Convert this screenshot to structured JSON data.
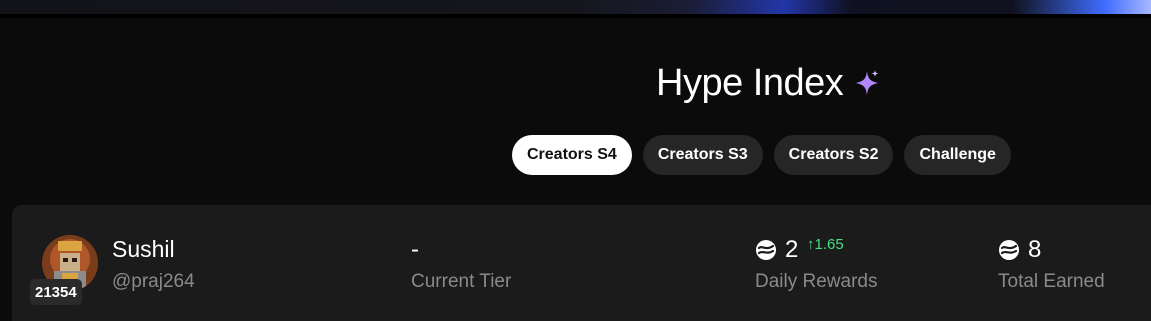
{
  "header": {
    "title": "Hype Index",
    "title_icon": "sparkle-icon",
    "sparkle_color": "#b388ff"
  },
  "tabs": [
    {
      "label": "Creators S4",
      "active": true
    },
    {
      "label": "Creators S3",
      "active": false
    },
    {
      "label": "Creators S2",
      "active": false
    },
    {
      "label": "Challenge",
      "active": false
    }
  ],
  "leaderboard_row": {
    "rank": "21354",
    "name": "Sushil",
    "handle": "@praj264",
    "tier": {
      "value": "-",
      "label": "Current Tier"
    },
    "daily_rewards": {
      "value": "2",
      "delta": "↑1.65",
      "label": "Daily Rewards",
      "icon": "coin-icon"
    },
    "total_earned": {
      "value": "8",
      "label": "Total Earned",
      "icon": "coin-icon"
    }
  },
  "colors": {
    "background": "#0b0b0b",
    "card": "#1b1b1b",
    "tab_inactive": "#262626",
    "tab_active": "#ffffff",
    "positive_delta": "#4ade80",
    "muted_text": "#8a8a8a"
  }
}
